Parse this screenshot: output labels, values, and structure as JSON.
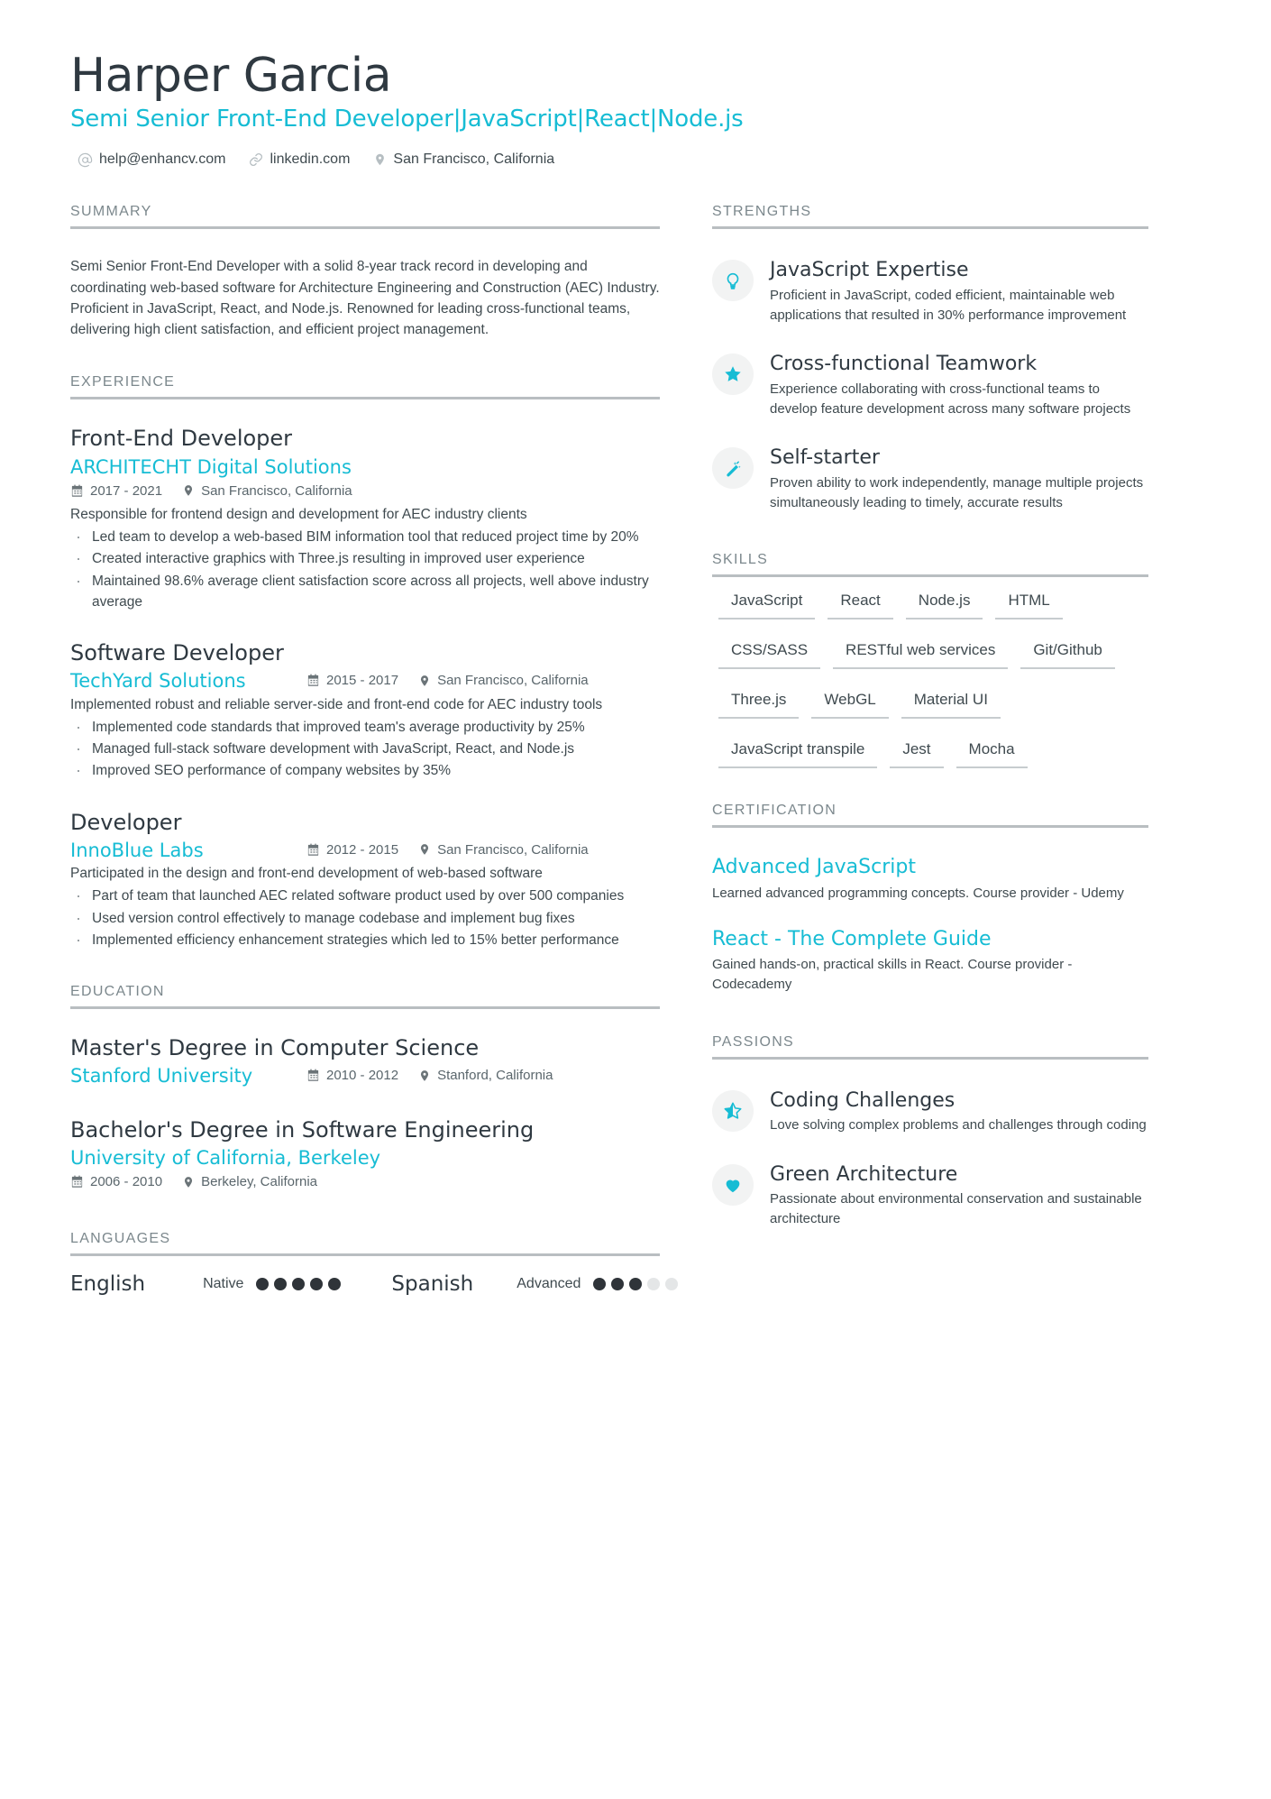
{
  "header": {
    "name": "Harper Garcia",
    "headline": "Semi Senior Front-End Developer|JavaScript|React|Node.js",
    "contacts": [
      {
        "icon": "at-icon",
        "text": "help@enhancv.com"
      },
      {
        "icon": "link-icon",
        "text": "linkedin.com"
      },
      {
        "icon": "location-pin-icon",
        "text": "San Francisco, California"
      }
    ]
  },
  "summary": {
    "title": "SUMMARY",
    "text": "Semi Senior Front-End Developer with a solid 8-year track record in developing and coordinating web-based software for Architecture Engineering and Construction (AEC) Industry. Proficient in JavaScript, React, and Node.js. Renowned for leading cross-functional teams, delivering high client satisfaction, and efficient project management."
  },
  "experience": {
    "title": "EXPERIENCE",
    "entries": [
      {
        "role": "Front-End Developer",
        "company": "ARCHITECHT Digital Solutions",
        "dates": "2017 - 2021",
        "location": "San Francisco, California",
        "inline_meta": false,
        "description": "Responsible for frontend design and development for AEC industry clients",
        "bullets": [
          "Led team to develop a web-based BIM information tool that reduced project time by 20%",
          "Created interactive graphics with Three.js resulting in improved user experience",
          "Maintained 98.6% average client satisfaction score across all projects, well above industry average"
        ]
      },
      {
        "role": "Software Developer",
        "company": "TechYard Solutions",
        "dates": "2015 - 2017",
        "location": "San Francisco, California",
        "inline_meta": true,
        "description": "Implemented robust and reliable server-side and front-end code for AEC industry tools",
        "bullets": [
          "Implemented code standards that improved team's average productivity by 25%",
          "Managed full-stack software development with JavaScript, React, and Node.js",
          "Improved SEO performance of company websites by 35%"
        ]
      },
      {
        "role": "Developer",
        "company": "InnoBlue Labs",
        "dates": "2012 - 2015",
        "location": "San Francisco, California",
        "inline_meta": true,
        "description": "Participated in the design and front-end development of web-based software",
        "bullets": [
          "Part of team that launched AEC related software product used by over 500 companies",
          "Used version control effectively to manage codebase and implement bug fixes",
          "Implemented efficiency enhancement strategies which led to 15% better performance"
        ]
      }
    ]
  },
  "education": {
    "title": "EDUCATION",
    "entries": [
      {
        "degree": "Master's Degree in Computer Science",
        "school": "Stanford University",
        "dates": "2010 - 2012",
        "location": "Stanford, California",
        "inline_meta": true
      },
      {
        "degree": "Bachelor's Degree in Software Engineering",
        "school": "University of California, Berkeley",
        "dates": "2006 - 2010",
        "location": "Berkeley, California",
        "inline_meta": false
      }
    ]
  },
  "languages": {
    "title": "LANGUAGES",
    "items": [
      {
        "name": "English",
        "level": "Native",
        "filled": 5,
        "total": 5
      },
      {
        "name": "Spanish",
        "level": "Advanced",
        "filled": 3,
        "total": 5
      }
    ]
  },
  "strengths": {
    "title": "STRENGTHS",
    "items": [
      {
        "icon": "lightbulb-icon",
        "title": "JavaScript Expertise",
        "text": "Proficient in JavaScript, coded efficient, maintainable web applications that resulted in 30% performance improvement"
      },
      {
        "icon": "star-icon",
        "title": "Cross-functional Teamwork",
        "text": "Experience collaborating with cross-functional teams to develop feature development across many software projects"
      },
      {
        "icon": "magic-wand-icon",
        "title": "Self-starter",
        "text": "Proven ability to work independently, manage multiple projects simultaneously leading to timely, accurate results"
      }
    ]
  },
  "skills": {
    "title": "SKILLS",
    "items": [
      "JavaScript",
      "React",
      "Node.js",
      "HTML",
      "CSS/SASS",
      "RESTful web services",
      "Git/Github",
      "Three.js",
      "WebGL",
      "Material UI",
      "JavaScript transpile",
      "Jest",
      "Mocha"
    ]
  },
  "certification": {
    "title": "CERTIFICATION",
    "items": [
      {
        "name": "Advanced JavaScript",
        "text": "Learned advanced programming concepts. Course provider - Udemy"
      },
      {
        "name": "React - The Complete Guide",
        "text": "Gained hands-on, practical skills in React. Course provider - Codecademy"
      }
    ]
  },
  "passions": {
    "title": "PASSIONS",
    "items": [
      {
        "icon": "half-star-icon",
        "title": "Coding Challenges",
        "text": "Love solving complex problems and challenges through coding"
      },
      {
        "icon": "heart-icon",
        "title": "Green Architecture",
        "text": "Passionate about environmental conservation and sustainable architecture"
      }
    ]
  },
  "colors": {
    "accent": "#16bcd4",
    "text": "#3f4a4f",
    "heading": "#2f3941",
    "muted": "#7c888d",
    "rule": "#b9bec1"
  }
}
